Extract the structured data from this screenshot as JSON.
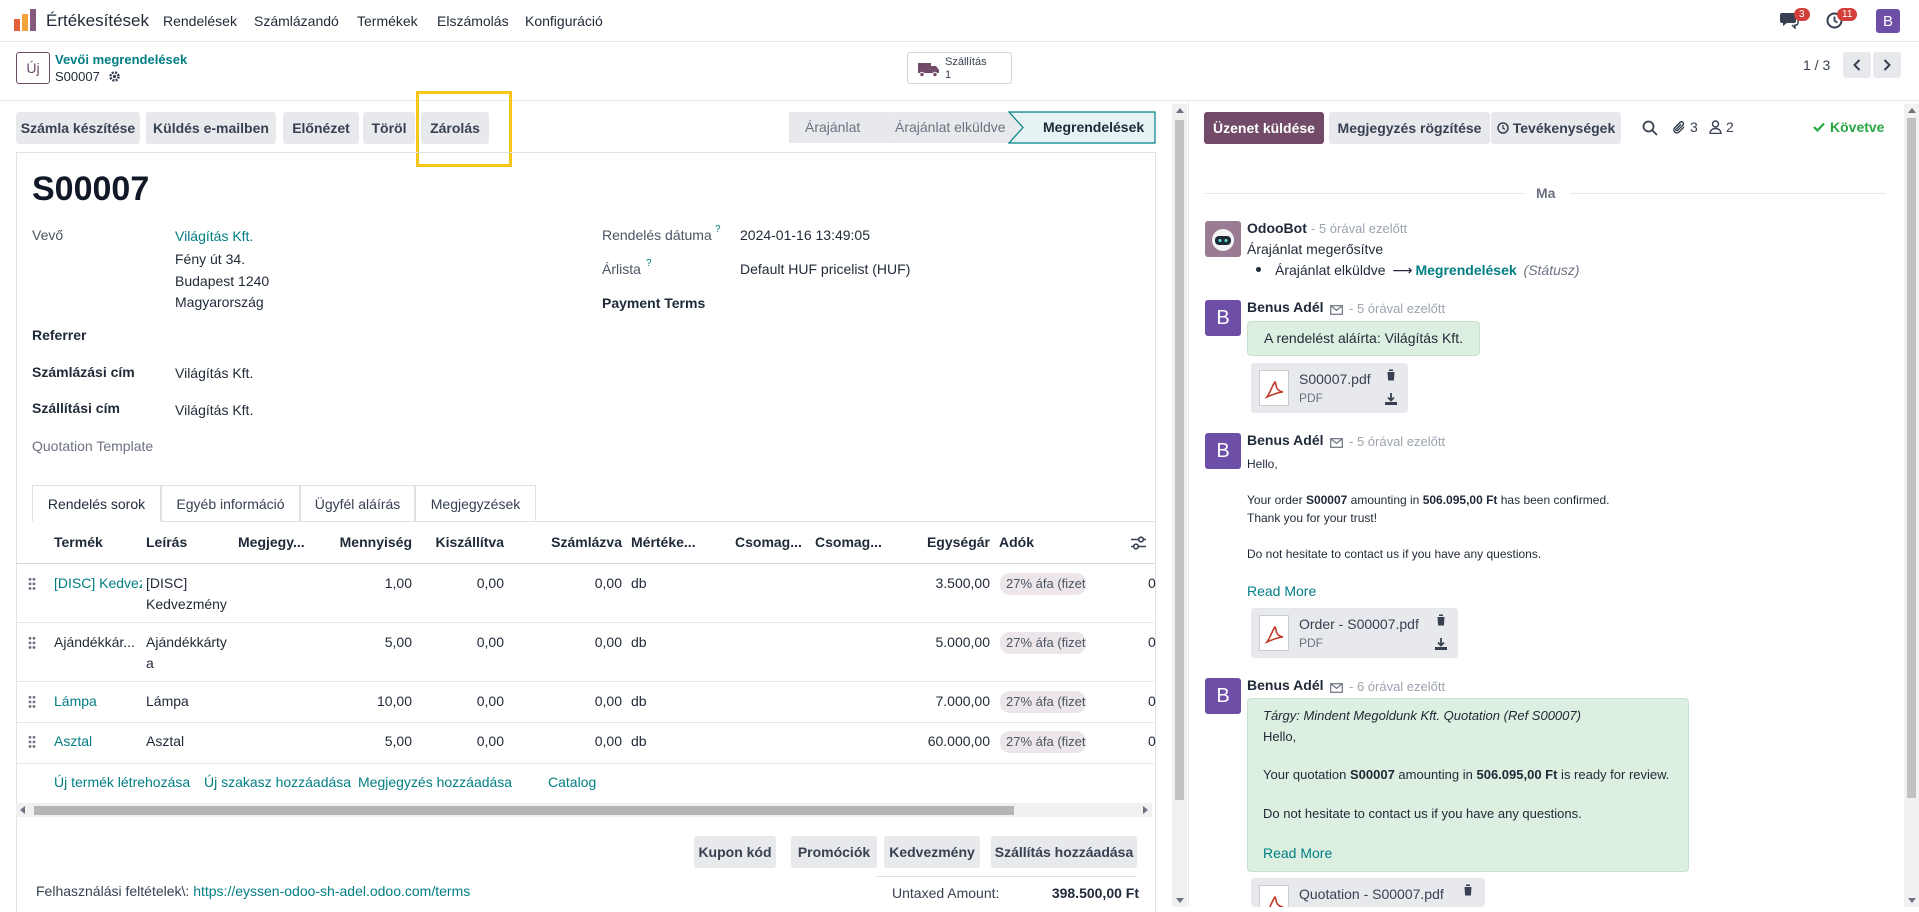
{
  "nav": {
    "app_name": "Értékesítések",
    "menu": [
      "Rendelések",
      "Számlázandó",
      "Termékek",
      "Elszámolás",
      "Konfiguráció"
    ],
    "messages_count": "3",
    "activities_count": "11",
    "user_initial": "B"
  },
  "control": {
    "new_button": "Új",
    "breadcrumb_parent": "Vevői megrendelések",
    "record_name": "S00007",
    "smart_button_label": "Szállítás",
    "smart_button_count": "1",
    "pager": "1 / 3"
  },
  "actions": [
    "Számla készítése",
    "Küldés e-mailben",
    "Előnézet",
    "Töröl",
    "Zárolás"
  ],
  "status_steps": [
    "Árajánlat",
    "Árajánlat elküldve",
    "Megrendelések"
  ],
  "form": {
    "title": "S00007",
    "customer_label": "Vevő",
    "customer_name": "Világítás Kft.",
    "address_line1": "Fény út 34.",
    "address_line2": "Budapest 1240",
    "address_line3": "Magyarország",
    "referrer_label": "Referrer",
    "invoice_address_label": "Számlázási cím",
    "invoice_address": "Világítás Kft.",
    "delivery_address_label": "Szállítási cím",
    "delivery_address": "Világítás Kft.",
    "quotation_template_label": "Quotation Template",
    "order_date_label": "Rendelés dátuma",
    "order_date": "2024-01-16 13:49:05",
    "pricelist_label": "Árlista",
    "pricelist": "Default HUF pricelist (HUF)",
    "payment_terms_label": "Payment Terms",
    "help_mark": "?"
  },
  "tabs": [
    "Rendelés sorok",
    "Egyéb információ",
    "Ügyfél aláírás",
    "Megjegyzések"
  ],
  "table": {
    "headers": [
      "Termék",
      "Leírás",
      "Megjegy...",
      "Mennyiség",
      "Kiszállítva",
      "Számlázva",
      "Mértéke...",
      "Csomag...",
      "Csomag...",
      "Egységár",
      "Adók"
    ],
    "rows": [
      {
        "product": "[DISC] Kedvez",
        "desc1": "[DISC]",
        "desc2": "Kedvezmény",
        "qty": "1,00",
        "delivered": "0,00",
        "invoiced": "0,00",
        "uom": "db",
        "price": "3.500,00",
        "tax": "27% áfa (fizet",
        "trail": "0"
      },
      {
        "product": "Ajándékkár...",
        "desc1": "Ajándékkárty",
        "desc2": "a",
        "qty": "5,00",
        "delivered": "0,00",
        "invoiced": "0,00",
        "uom": "db",
        "price": "5.000,00",
        "tax": "27% áfa (fizet",
        "trail": "0"
      },
      {
        "product": "Lámpa",
        "desc1": "Lámpa",
        "desc2": "",
        "qty": "10,00",
        "delivered": "0,00",
        "invoiced": "0,00",
        "uom": "db",
        "price": "7.000,00",
        "tax": "27% áfa (fizet",
        "trail": "0"
      },
      {
        "product": "Asztal",
        "desc1": "Asztal",
        "desc2": "",
        "qty": "5,00",
        "delivered": "0,00",
        "invoiced": "0,00",
        "uom": "db",
        "price": "60.000,00",
        "tax": "27% áfa (fizet",
        "trail": "0"
      }
    ],
    "add_links": [
      "Új termék létrehozása",
      "Új szakasz hozzáadása",
      "Megjegyzés hozzáadása",
      "Catalog"
    ]
  },
  "bottom_buttons": [
    "Kupon kód",
    "Promóciók",
    "Kedvezmény",
    "Szállítás hozzáadása"
  ],
  "terms": {
    "label": "Felhasználási feltételek\\: ",
    "url": "https://eyssen-odoo-sh-adel.odoo.com/terms"
  },
  "totals": {
    "untaxed_label": "Untaxed Amount:",
    "untaxed_value": "398.500,00 Ft"
  },
  "chatter": {
    "send_message": "Üzenet küldése",
    "log_note": "Megjegyzés rögzítése",
    "activities": "Tevékenységek",
    "attachments_count": "3",
    "followers_count": "2",
    "following": "Követve",
    "date_separator": "Ma",
    "messages": [
      {
        "author": "OdooBot",
        "time": "- 5 órával ezelőtt",
        "text": "Árajánlat megerősítve",
        "tracking_old": "Árajánlat elküldve",
        "tracking_arrow": "⟶",
        "tracking_new": "Megrendelések",
        "tracking_field": "(Státusz)"
      },
      {
        "author": "Benus Adél",
        "time": "- 5 órával ezelőtt",
        "text": "A rendelést aláírta: Világítás Kft.",
        "attachment_name": "S00007.pdf",
        "attachment_type": "PDF"
      },
      {
        "author": "Benus Adél",
        "time": "- 5 órával ezelőtt",
        "hello": "Hello,",
        "line1_a": "Your order ",
        "line1_b": "S00007",
        "line1_c": " amounting in ",
        "line1_d": "506.095,00 Ft",
        "line1_e": " has been confirmed.",
        "line2": "Thank you for your trust!",
        "line3": "Do not hesitate to contact us if you have any questions.",
        "read_more": "Read More",
        "attachment_name": "Order - S00007.pdf",
        "attachment_type": "PDF"
      },
      {
        "author": "Benus Adél",
        "time": "- 6 órával ezelőtt",
        "subject": "Tárgy: Mindent Megoldunk Kft. Quotation (Ref S00007)",
        "hello": "Hello,",
        "line1_a": "Your quotation ",
        "line1_b": "S00007",
        "line1_c": " amounting in ",
        "line1_d": "506.095,00 Ft",
        "line1_e": " is ready for review.",
        "line2": "Do not hesitate to contact us if you have any questions.",
        "read_more": "Read More",
        "attachment_name": "Quotation - S00007.pdf"
      }
    ]
  },
  "colors": {
    "brand": "#714b67",
    "link": "#017e84",
    "highlight": "#f5c518",
    "avatar": "#6d4fa8"
  }
}
